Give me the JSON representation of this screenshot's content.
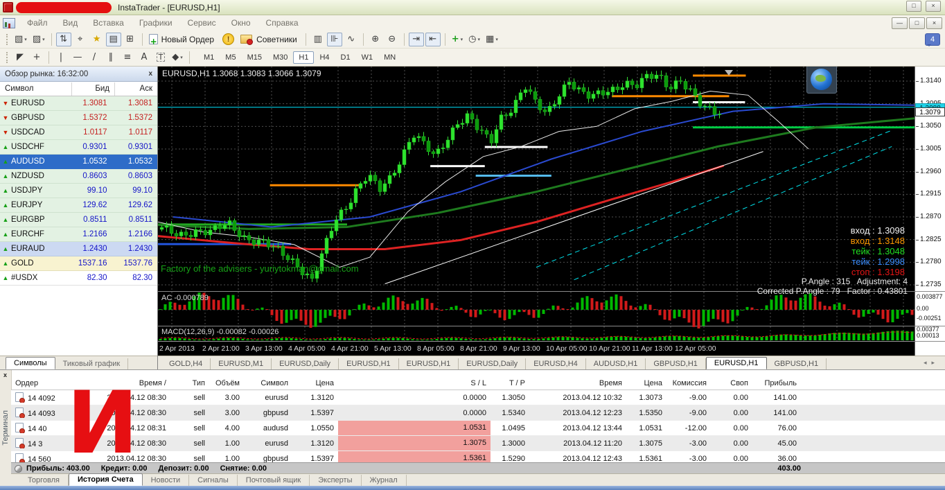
{
  "window": {
    "title": "InstaTrader - [EURUSD,H1]"
  },
  "menu": {
    "items": [
      "Файл",
      "Вид",
      "Вставка",
      "Графики",
      "Сервис",
      "Окно",
      "Справка"
    ]
  },
  "toolbar": {
    "new_order": "Новый Ордер",
    "advisors": "Советники",
    "timeframes": [
      "M1",
      "M5",
      "M15",
      "M30",
      "H1",
      "H4",
      "D1",
      "W1",
      "MN"
    ],
    "active_timeframe": "H1",
    "notification_count": "4",
    "row1": [
      {
        "t": "btn",
        "name": "new-chart-button",
        "icon": "▧",
        "dd": true
      },
      {
        "t": "btn",
        "name": "profiles-button",
        "icon": "▨",
        "dd": true
      },
      {
        "t": "sep"
      },
      {
        "t": "btn",
        "name": "tick-chart-button",
        "icon": "⇅",
        "pressed": true
      },
      {
        "t": "btn",
        "name": "crosshair-mode-button",
        "icon": "⌖"
      },
      {
        "t": "btn",
        "name": "favorites-button",
        "icon": "★",
        "cls": "gold"
      },
      {
        "t": "btn",
        "name": "market-watch-button",
        "icon": "▤",
        "pressed": true
      },
      {
        "t": "btn",
        "name": "data-window-button",
        "icon": "⊞"
      },
      {
        "t": "sep"
      },
      {
        "t": "neworder"
      },
      {
        "t": "warn"
      },
      {
        "t": "advisors"
      },
      {
        "t": "sep"
      },
      {
        "t": "btn",
        "name": "bar-chart-button",
        "icon": "▥"
      },
      {
        "t": "btn",
        "name": "candlestick-chart-button",
        "icon": "⊪",
        "pressed": true
      },
      {
        "t": "btn",
        "name": "line-chart-button",
        "icon": "∿"
      },
      {
        "t": "sep"
      },
      {
        "t": "btn",
        "name": "zoom-in-button",
        "icon": "⊕"
      },
      {
        "t": "btn",
        "name": "zoom-out-button",
        "icon": "⊖"
      },
      {
        "t": "sep"
      },
      {
        "t": "btn",
        "name": "auto-scroll-button",
        "icon": "⇥",
        "pressed": true
      },
      {
        "t": "btn",
        "name": "chart-shift-button",
        "icon": "⇤",
        "pressed": true
      },
      {
        "t": "sep"
      },
      {
        "t": "btn",
        "name": "indicators-button",
        "icon": "+",
        "cls": "green",
        "dd": true
      },
      {
        "t": "btn",
        "name": "periods-button",
        "icon": "◷",
        "dd": true
      },
      {
        "t": "btn",
        "name": "templates-button",
        "icon": "▦",
        "dd": true
      }
    ],
    "row2": [
      {
        "t": "btn",
        "name": "cursor-button",
        "icon": "◤"
      },
      {
        "t": "btn",
        "name": "crosshair-button",
        "icon": "+"
      },
      {
        "t": "sep"
      },
      {
        "t": "btn",
        "name": "vertical-line-button",
        "icon": "|"
      },
      {
        "t": "btn",
        "name": "horizontal-line-button",
        "icon": "—"
      },
      {
        "t": "btn",
        "name": "trendline-button",
        "icon": "/"
      },
      {
        "t": "btn",
        "name": "channel-button",
        "icon": "∥"
      },
      {
        "t": "btn",
        "name": "fibonacci-button",
        "icon": "≡"
      },
      {
        "t": "btn",
        "name": "text-button",
        "icon": "A"
      },
      {
        "t": "btn",
        "name": "label-button",
        "icon": "T",
        "cls": "boxed"
      },
      {
        "t": "btn",
        "name": "shapes-button",
        "icon": "◆",
        "dd": true
      },
      {
        "t": "sep"
      },
      {
        "t": "timeframes"
      }
    ]
  },
  "market_watch": {
    "title": "Обзор рынка: 16:32:00",
    "columns": [
      "Символ",
      "Бид",
      "Аск"
    ],
    "rows": [
      {
        "symbol": "EURUSD",
        "bid": "1.3081",
        "ask": "1.3081",
        "trend": "down",
        "highlight": "none"
      },
      {
        "symbol": "GBPUSD",
        "bid": "1.5372",
        "ask": "1.5372",
        "trend": "down",
        "highlight": "none"
      },
      {
        "symbol": "USDCAD",
        "bid": "1.0117",
        "ask": "1.0117",
        "trend": "down",
        "highlight": "none"
      },
      {
        "symbol": "USDCHF",
        "bid": "0.9301",
        "ask": "0.9301",
        "trend": "up",
        "highlight": "none"
      },
      {
        "symbol": "AUDUSD",
        "bid": "1.0532",
        "ask": "1.0532",
        "trend": "up",
        "highlight": "selected"
      },
      {
        "symbol": "NZDUSD",
        "bid": "0.8603",
        "ask": "0.8603",
        "trend": "up",
        "highlight": "none"
      },
      {
        "symbol": "USDJPY",
        "bid": "99.10",
        "ask": "99.10",
        "trend": "up",
        "highlight": "none"
      },
      {
        "symbol": "EURJPY",
        "bid": "129.62",
        "ask": "129.62",
        "trend": "up",
        "highlight": "none"
      },
      {
        "symbol": "EURGBP",
        "bid": "0.8511",
        "ask": "0.8511",
        "trend": "up",
        "highlight": "none"
      },
      {
        "symbol": "EURCHF",
        "bid": "1.2166",
        "ask": "1.2166",
        "trend": "up",
        "highlight": "none"
      },
      {
        "symbol": "EURAUD",
        "bid": "1.2430",
        "ask": "1.2430",
        "trend": "up",
        "highlight": "blue"
      },
      {
        "symbol": "GOLD",
        "bid": "1537.16",
        "ask": "1537.76",
        "trend": "up",
        "highlight": "gold"
      },
      {
        "symbol": "#USDX",
        "bid": "82.30",
        "ask": "82.30",
        "trend": "up",
        "highlight": "white"
      }
    ],
    "tabs": [
      "Символы",
      "Тиковый график"
    ],
    "active_tab": "Символы"
  },
  "chart": {
    "header": "EURUSD,H1  1.3068 1.3083 1.3066 1.3079",
    "watermark": "Factory of the advisers - yuriytokman@gmail.com",
    "annotations": [
      {
        "label": "вход",
        "value": "1.3098",
        "color": "#f2f2f2"
      },
      {
        "label": "вход",
        "value": "1.3148",
        "color": "#ff9900"
      },
      {
        "label": "тейк",
        "value": "1.3048",
        "color": "#22e022"
      },
      {
        "label": "тейк",
        "value": "1.2998",
        "color": "#3b8eff"
      },
      {
        "label": "стоп",
        "value": "1.3198",
        "color": "#e81414"
      }
    ],
    "angle_line1": "P.Angle : 315   Adjustment: 4",
    "angle_line2": "Corrected P.Angle : 79   Factor : 0.43801",
    "price_scale": {
      "top_price": 1.314,
      "bottom_price": 1.2735,
      "labels": [
        "1.3140",
        "1.3095",
        "1.3050",
        "1.3005",
        "1.2960",
        "1.2915",
        "1.2870",
        "1.2825",
        "1.2780",
        "1.2735"
      ],
      "ask_badge": "1.3088",
      "bid_badge": "1.3079"
    },
    "ac": {
      "label": "AC -0.000789",
      "scale": [
        "0.003877",
        "0.00",
        "-0.00251"
      ]
    },
    "macd": {
      "label": "MACD(12,26,9) -0.00082 -0.00026",
      "scale": [
        "0.00377",
        "0.00013"
      ]
    },
    "time_axis": [
      "2 Apr 2013",
      "2 Apr 21:00",
      "3 Apr 13:00",
      "4 Apr 05:00",
      "4 Apr 21:00",
      "5 Apr 13:00",
      "8 Apr 05:00",
      "8 Apr 21:00",
      "9 Apr 13:00",
      "10 Apr 05:00",
      "10 Apr 21:00",
      "11 Apr 13:00",
      "12 Apr 05:00"
    ],
    "price_anchors": [
      [
        0.0,
        1.2845
      ],
      [
        0.03,
        1.2832
      ],
      [
        0.06,
        1.2845
      ],
      [
        0.09,
        1.284
      ],
      [
        0.12,
        1.2855
      ],
      [
        0.15,
        1.283
      ],
      [
        0.18,
        1.282
      ],
      [
        0.21,
        1.28
      ],
      [
        0.24,
        1.278
      ],
      [
        0.27,
        1.2745
      ],
      [
        0.29,
        1.28
      ],
      [
        0.31,
        1.286
      ],
      [
        0.33,
        1.289
      ],
      [
        0.35,
        1.293
      ],
      [
        0.37,
        1.2955
      ],
      [
        0.39,
        1.292
      ],
      [
        0.41,
        1.2945
      ],
      [
        0.43,
        1.299
      ],
      [
        0.45,
        1.304
      ],
      [
        0.47,
        1.3015
      ],
      [
        0.49,
        1.2985
      ],
      [
        0.51,
        1.302
      ],
      [
        0.53,
        1.306
      ],
      [
        0.55,
        1.3075
      ],
      [
        0.57,
        1.304
      ],
      [
        0.59,
        1.3015
      ],
      [
        0.61,
        1.307
      ],
      [
        0.63,
        1.309
      ],
      [
        0.65,
        1.3135
      ],
      [
        0.67,
        1.3095
      ],
      [
        0.69,
        1.307
      ],
      [
        0.71,
        1.311
      ],
      [
        0.73,
        1.3145
      ],
      [
        0.75,
        1.312
      ],
      [
        0.77,
        1.3105
      ],
      [
        0.79,
        1.3115
      ],
      [
        0.81,
        1.3125
      ],
      [
        0.83,
        1.314
      ],
      [
        0.85,
        1.313
      ],
      [
        0.87,
        1.3145
      ],
      [
        0.89,
        1.315
      ],
      [
        0.91,
        1.313
      ],
      [
        0.93,
        1.3145
      ],
      [
        0.95,
        1.3115
      ],
      [
        0.97,
        1.3085
      ],
      [
        0.99,
        1.3079
      ]
    ],
    "levels": [
      {
        "color": "#ff8a00",
        "x1": 0.148,
        "x2": 0.267,
        "price": 1.2933,
        "w": 3
      },
      {
        "color": "#ff8a00",
        "x1": 0.6,
        "x2": 0.755,
        "price": 1.311,
        "w": 3
      },
      {
        "color": "#ff8a00",
        "x1": 0.707,
        "x2": 0.777,
        "price": 1.3151,
        "w": 3
      },
      {
        "color": "#ffffff",
        "x1": 0.36,
        "x2": 0.432,
        "price": 1.2971,
        "w": 3
      },
      {
        "color": "#ffffff",
        "x1": 0.432,
        "x2": 0.515,
        "price": 1.3009,
        "w": 3
      },
      {
        "color": "#ffffff",
        "x1": 0.707,
        "x2": 0.776,
        "price": 1.3098,
        "w": 3
      },
      {
        "color": "#2255dd",
        "x1": 0.0,
        "x2": 0.176,
        "price": 1.2816,
        "w": 3
      },
      {
        "color": "#55bbee",
        "x1": 0.42,
        "x2": 0.52,
        "price": 1.2952,
        "w": 3
      },
      {
        "color": "#22aa22",
        "x1": 0.0,
        "x2": 0.25,
        "price": 1.2855,
        "w": 3
      },
      {
        "color": "#00cc44",
        "x1": 0.707,
        "x2": 1.0,
        "price": 1.3048,
        "w": 3
      },
      {
        "color": "#00e5ff",
        "x1": 0.0,
        "x2": 1.0,
        "price": 1.3088,
        "w": 1
      }
    ],
    "ma_lines": [
      {
        "color": "#dd2222",
        "width": 3,
        "pts": [
          [
            0,
            1.2832
          ],
          [
            0.1,
            1.2818
          ],
          [
            0.2,
            1.2806
          ],
          [
            0.3,
            1.2806
          ],
          [
            0.4,
            1.2824
          ],
          [
            0.5,
            1.286
          ],
          [
            0.6,
            1.2905
          ],
          [
            0.68,
            1.294
          ],
          [
            0.748,
            1.2972
          ]
        ]
      },
      {
        "color": "#1e7a1e",
        "width": 3,
        "pts": [
          [
            0,
            1.2854
          ],
          [
            0.12,
            1.2846
          ],
          [
            0.25,
            1.285
          ],
          [
            0.37,
            1.2878
          ],
          [
            0.5,
            1.292
          ],
          [
            0.62,
            1.2965
          ],
          [
            0.74,
            1.301
          ],
          [
            0.87,
            1.3048
          ],
          [
            1.0,
            1.3066
          ]
        ]
      },
      {
        "color": "#2a4ad0",
        "width": 2,
        "pts": [
          [
            0.02,
            1.287
          ],
          [
            0.15,
            1.285
          ],
          [
            0.28,
            1.287
          ],
          [
            0.4,
            1.292
          ],
          [
            0.52,
            1.2985
          ],
          [
            0.64,
            1.304
          ],
          [
            0.76,
            1.308
          ],
          [
            0.88,
            1.3095
          ],
          [
            1.0,
            1.3092
          ]
        ]
      },
      {
        "color": "#e8e8e8",
        "width": 1,
        "pts": [
          [
            0,
            1.286
          ],
          [
            0.06,
            1.284
          ],
          [
            0.12,
            1.283
          ],
          [
            0.18,
            1.2815
          ],
          [
            0.24,
            1.277
          ],
          [
            0.28,
            1.279
          ],
          [
            0.33,
            1.288
          ],
          [
            0.38,
            1.294
          ],
          [
            0.43,
            1.299
          ],
          [
            0.48,
            1.301
          ],
          [
            0.53,
            1.304
          ],
          [
            0.58,
            1.305
          ],
          [
            0.63,
            1.3085
          ],
          [
            0.68,
            1.31
          ],
          [
            0.73,
            1.312
          ],
          [
            0.78,
            1.3112
          ],
          [
            0.82,
            1.306
          ],
          [
            0.86,
            1.3005
          ]
        ]
      },
      {
        "color": "#ffffff",
        "width": 1,
        "pts": [
          [
            0.3,
            1.2737
          ],
          [
            0.8,
            1.3
          ]
        ]
      },
      {
        "color": "#00e5ee",
        "width": 1,
        "dash": "7,5",
        "pts": [
          [
            0.5,
            1.277
          ],
          [
            0.97,
            1.3042
          ]
        ]
      },
      {
        "color": "#00e5ee",
        "width": 1,
        "dash": "7,5",
        "pts": [
          [
            0.55,
            1.2745
          ],
          [
            0.97,
            1.301
          ]
        ]
      }
    ]
  },
  "chart_tabs": {
    "tabs": [
      "GOLD,H4",
      "EURUSD,M1",
      "EURUSD,Daily",
      "EURUSD,H1",
      "EURUSD,H1",
      "EURUSD,Daily",
      "EURUSD,H4",
      "AUDUSD,H1",
      "GBPUSD,H1",
      "EURUSD,H1",
      "GBPUSD,H1"
    ],
    "active_index": 9
  },
  "terminal": {
    "columns": [
      "Ордер",
      "Время  /",
      "Тип",
      "Объём",
      "Символ",
      "Цена",
      "S / L",
      "T / P",
      "Время",
      "Цена",
      "Комиссия",
      "Своп",
      "Прибыль"
    ],
    "rows": [
      {
        "cells": [
          "14 4092",
          "2013.04.12 08:30",
          "sell",
          "3.00",
          "eurusd",
          "1.3120",
          "0.0000",
          "1.3050",
          "2013.04.12 10:32",
          "1.3073",
          "-9.00",
          "0.00",
          "141.00"
        ],
        "sl_alert": false
      },
      {
        "cells": [
          "14 4093",
          "2013.04.12 08:30",
          "sell",
          "3.00",
          "gbpusd",
          "1.5397",
          "0.0000",
          "1.5340",
          "2013.04.12 12:23",
          "1.5350",
          "-9.00",
          "0.00",
          "141.00"
        ],
        "sl_alert": false
      },
      {
        "cells": [
          "14 40",
          "2013.04.12 08:31",
          "sell",
          "4.00",
          "audusd",
          "1.0550",
          "1.0531",
          "1.0495",
          "2013.04.12 13:44",
          "1.0531",
          "-12.00",
          "0.00",
          "76.00"
        ],
        "sl_alert": true
      },
      {
        "cells": [
          "14 3",
          "2013.04.12 08:30",
          "sell",
          "1.00",
          "eurusd",
          "1.3120",
          "1.3075",
          "1.3000",
          "2013.04.12 11:20",
          "1.3075",
          "-3.00",
          "0.00",
          "45.00"
        ],
        "sl_alert": true
      },
      {
        "cells": [
          "14 560",
          "2013.04.12 08:30",
          "sell",
          "1.00",
          "gbpusd",
          "1.5397",
          "1.5361",
          "1.5290",
          "2013.04.12 12:43",
          "1.5361",
          "-3.00",
          "0.00",
          "36.00"
        ],
        "sl_alert": true
      }
    ],
    "status": {
      "items": [
        "Прибыль: 403.00",
        "Кредит: 0.00",
        "Депозит: 0.00",
        "Снятие: 0.00"
      ],
      "total": "403.00"
    },
    "tabs": [
      "Торговля",
      "История Счета",
      "Новости",
      "Сигналы",
      "Почтовый ящик",
      "Эксперты",
      "Журнал"
    ],
    "active_tab": "История Счета",
    "side_label": "Терминал",
    "annotation_letter": "И"
  }
}
